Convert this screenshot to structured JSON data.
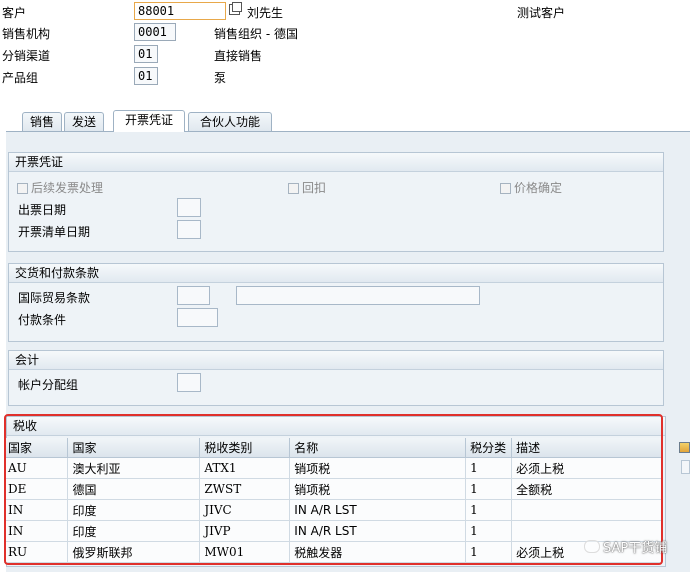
{
  "header": {
    "customer_label": "客户",
    "customer_value": "88001",
    "customer_name": "刘先生",
    "customer_desc": "测试客户",
    "sales_org_label": "销售机构",
    "sales_org_value": "0001",
    "sales_org_text": "销售组织 - 德国",
    "dist_channel_label": "分销渠道",
    "dist_channel_value": "01",
    "dist_channel_text": "直接销售",
    "division_label": "产品组",
    "division_value": "01",
    "division_text": "泵"
  },
  "tabs": [
    {
      "label": "销售"
    },
    {
      "label": "发送"
    },
    {
      "label": "开票凭证",
      "active": true
    },
    {
      "label": "合伙人功能"
    }
  ],
  "billing_doc": {
    "title": "开票凭证",
    "chk_subsequent_invoice": "后续发票处理",
    "chk_rebate": "回扣",
    "chk_price_determination": "价格确定",
    "invoice_dates_label": "出票日期",
    "invoice_list_dates_label": "开票清单日期"
  },
  "delivery_payment": {
    "title": "交货和付款条款",
    "incoterms_label": "国际贸易条款",
    "payment_terms_label": "付款条件"
  },
  "accounting": {
    "title": "会计",
    "acct_assign_group_label": "帐户分配组"
  },
  "taxes": {
    "title": "税收",
    "columns": [
      "国家",
      "国家",
      "税收类别",
      "名称",
      "税分类",
      "描述"
    ],
    "rows": [
      [
        "AU",
        "澳大利亚",
        "ATX1",
        "销项税",
        "1",
        "必须上税"
      ],
      [
        "DE",
        "德国",
        "ZWST",
        "销项税",
        "1",
        "全额税"
      ],
      [
        "IN",
        "印度",
        "JIVC",
        "IN A/R LST",
        "1",
        ""
      ],
      [
        "IN",
        "印度",
        "JIVP",
        "IN A/R LST",
        "1",
        ""
      ],
      [
        "RU",
        "俄罗斯联邦",
        "MW01",
        "税触发器",
        "1",
        "必须上税"
      ]
    ]
  },
  "watermark": "SAP干货铺"
}
